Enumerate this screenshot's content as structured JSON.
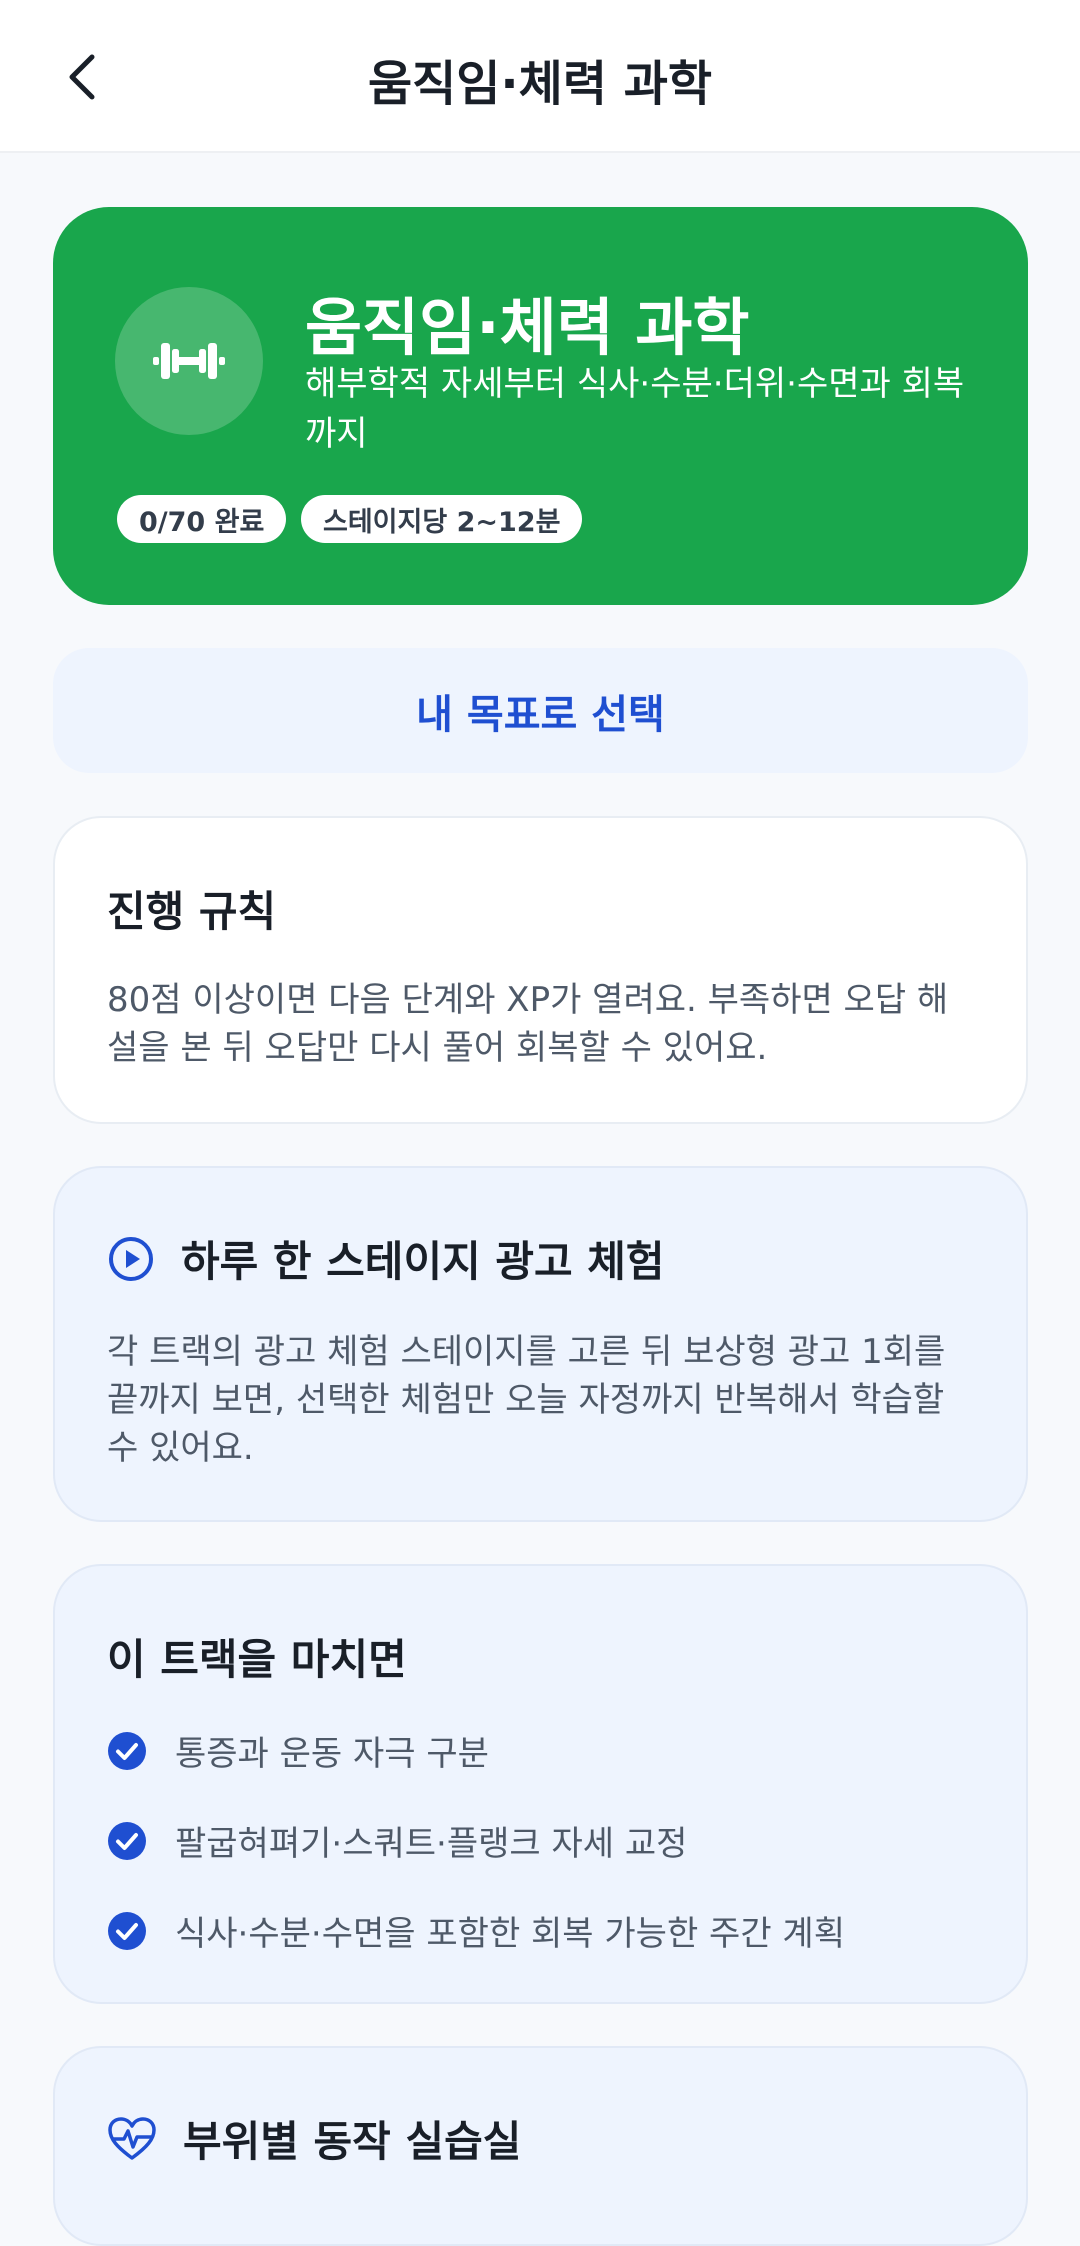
{
  "appbar": {
    "title": "움직임·체력 과학",
    "back_icon": "chevron-left-icon"
  },
  "hero": {
    "icon": "dumbbell-icon",
    "title": "움직임·체력 과학",
    "subtitle": "해부학적 자세부터 식사·수분·더위·수면과 회복까지",
    "chips": [
      "0/70 완료",
      "스테이지당 2~12분"
    ],
    "color": "#19a64c"
  },
  "goal_button": {
    "label": "내 목표로 선택",
    "color": "#1f4fd1"
  },
  "rules_card": {
    "title": "진행 규칙",
    "body": "80점 이상이면 다음 단계와 XP가 열려요. 부족하면 오답 해설을 본 뒤 오답만 다시 풀어 회복할 수 있어요."
  },
  "ad_card": {
    "icon": "play-circle-icon",
    "title": "하루 한 스테이지 광고 체험",
    "body": "각 트랙의 광고 체험 스테이지를 고른 뒤 보상형 광고 1회를 끝까지 보면, 선택한 체험만 오늘 자정까지 반복해서 학습할 수 있어요."
  },
  "outcomes_card": {
    "title": "이 트랙을 마치면",
    "items": [
      "통증과 운동 자극 구분",
      "팔굽혀펴기·스쿼트·플랭크 자세 교정",
      "식사·수분·수면을 포함한 회복 가능한 주간 계획"
    ]
  },
  "practice_card": {
    "icon": "heart-pulse-icon",
    "title": "부위별 동작 실습실"
  }
}
